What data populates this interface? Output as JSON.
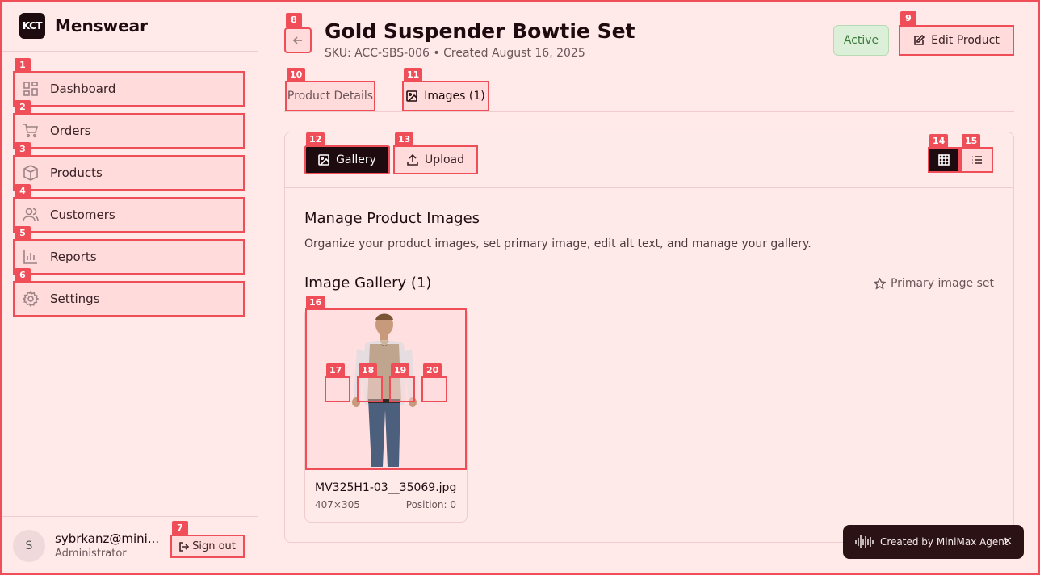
{
  "brand": {
    "logo_text": "KCT",
    "name": "Menswear"
  },
  "sidebar": {
    "items": [
      {
        "label": "Dashboard",
        "icon": "dashboard-icon"
      },
      {
        "label": "Orders",
        "icon": "cart-icon"
      },
      {
        "label": "Products",
        "icon": "box-icon"
      },
      {
        "label": "Customers",
        "icon": "users-icon"
      },
      {
        "label": "Reports",
        "icon": "bar-chart-icon"
      },
      {
        "label": "Settings",
        "icon": "gear-icon"
      }
    ],
    "user": {
      "initial": "S",
      "email": "sybrkanz@mini...",
      "role": "Administrator"
    },
    "sign_out": "Sign out"
  },
  "header": {
    "title": "Gold Suspender Bowtie Set",
    "meta": "SKU: ACC-SBS-006 • Created August 16, 2025",
    "status": "Active",
    "edit_label": "Edit Product"
  },
  "tabs": {
    "details": "Product Details",
    "images": "Images (1)"
  },
  "toolbar": {
    "gallery": "Gallery",
    "upload": "Upload"
  },
  "content": {
    "title": "Manage Product Images",
    "description": "Organize your product images, set primary image, edit alt text, and manage your gallery.",
    "gallery_title": "Image Gallery (1)",
    "primary_status": "Primary image set"
  },
  "image": {
    "file_name": "MV325H1-03__35069.jpg",
    "dimensions": "407×305",
    "position": "Position: 0"
  },
  "toast": {
    "text": "Created by MiniMax Agent",
    "close": "×"
  },
  "colors": {
    "accent": "#ef4e58",
    "dark": "#1e0b0f",
    "background": "#ffe9e9",
    "success": "#3c7a3c"
  }
}
